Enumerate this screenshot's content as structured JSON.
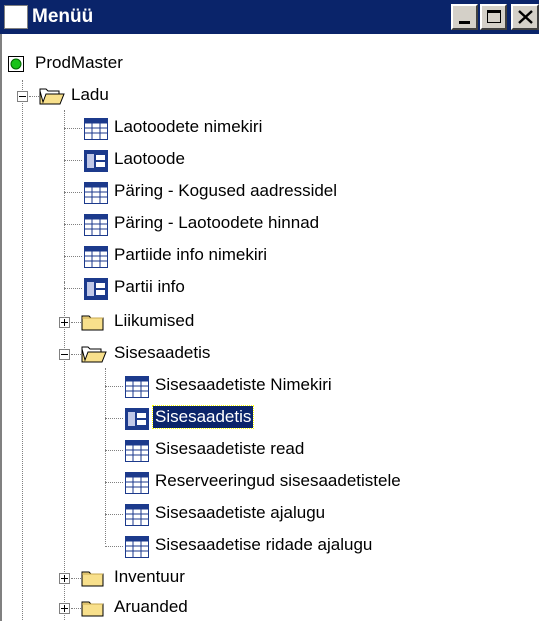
{
  "window": {
    "title": "Menüü",
    "icon": "window-app-icon",
    "title_bar_color": "#0a246a",
    "buttons": [
      "minimize-icon",
      "maximize-icon",
      "close-icon"
    ]
  },
  "tree": {
    "root": {
      "label": "ProdMaster",
      "icon": "green-circle-icon"
    },
    "ladu": {
      "label": "Ladu",
      "expanded": true
    },
    "ladu_items": [
      {
        "label": "Laotoodete nimekiri",
        "icon": "grid-icon"
      },
      {
        "label": "Laotoode",
        "icon": "form-icon"
      },
      {
        "label": "Päring - Kogused aadressidel",
        "icon": "grid-icon"
      },
      {
        "label": "Päring - Laotoodete hinnad",
        "icon": "grid-icon"
      },
      {
        "label": "Partiide info nimekiri",
        "icon": "grid-icon"
      },
      {
        "label": "Partii info",
        "icon": "form-icon"
      }
    ],
    "liikumised": {
      "label": "Liikumised",
      "expanded": false
    },
    "sisesaadetis": {
      "label": "Sisesaadetis",
      "expanded": true
    },
    "sisesaadetis_items": [
      {
        "label": "Sisesaadetiste Nimekiri",
        "icon": "grid-icon"
      },
      {
        "label": "Sisesaadetis",
        "icon": "form-icon",
        "selected": true
      },
      {
        "label": "Sisesaadetiste read",
        "icon": "grid-icon"
      },
      {
        "label": "Reserveeringud sisesaadetistele",
        "icon": "grid-icon"
      },
      {
        "label": "Sisesaadetiste ajalugu",
        "icon": "grid-icon"
      },
      {
        "label": "Sisesaadetise ridade ajalugu",
        "icon": "grid-icon"
      }
    ],
    "inventuur": {
      "label": "Inventuur",
      "expanded": false
    },
    "aruanded": {
      "label": "Aruanded",
      "expanded": false
    }
  },
  "colors": {
    "selection_bg": "#0a246a",
    "folder": "#f8e08c",
    "grid_header": "#1c3a8c"
  }
}
